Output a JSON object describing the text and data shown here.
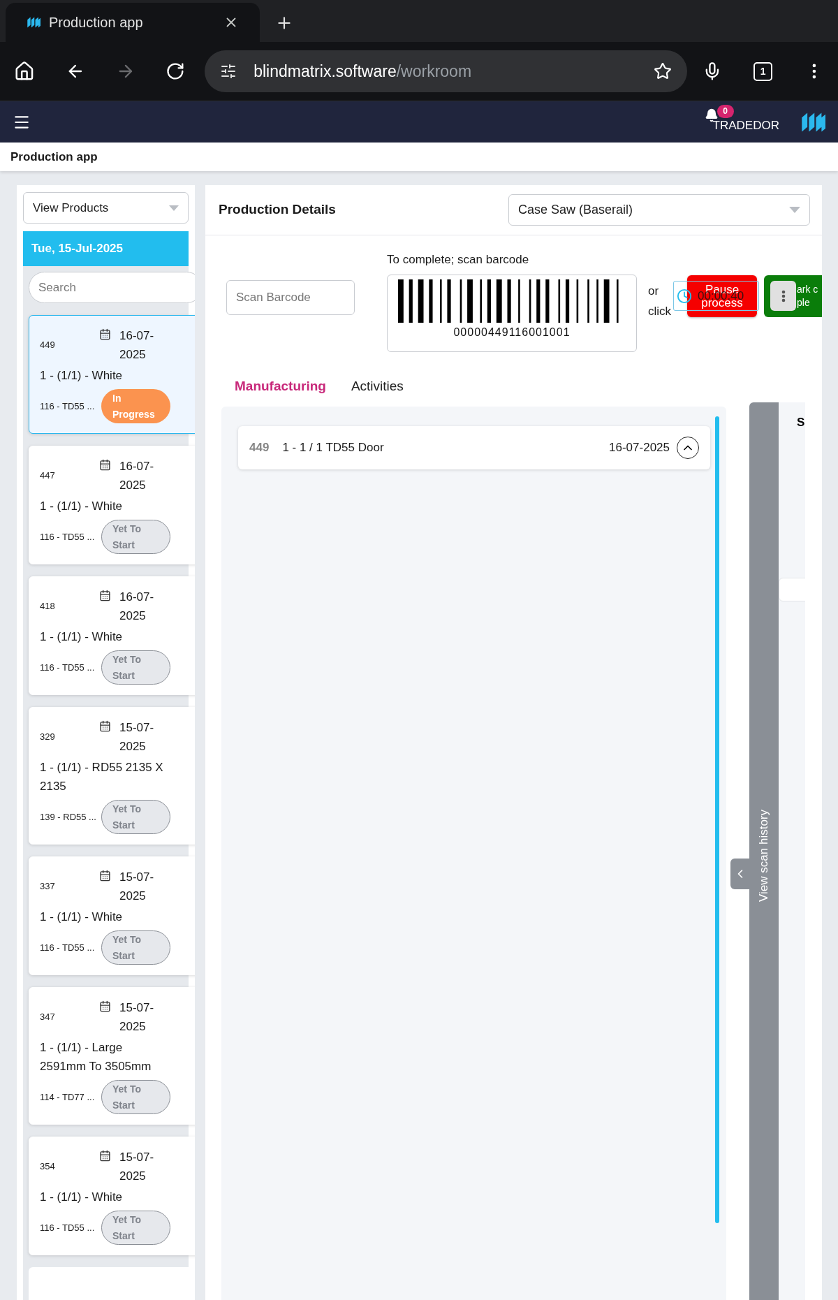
{
  "browser": {
    "tab_title": "Production app",
    "url_host": "blindmatrix.software",
    "url_path": "/workroom",
    "tab_count": "1",
    "forward_disabled": true
  },
  "header": {
    "notifications": "0",
    "user": "TRADEDOR"
  },
  "page_title": "Production app",
  "sidebar": {
    "product_select": "View Products",
    "date": "Tue, 15-Jul-2025",
    "search_placeholder": "Search",
    "orders": [
      {
        "number": "449",
        "date": "16-07-2025",
        "description": "1 - (1/1) - White",
        "code": "116 - TD55 ...",
        "status": "In Progress",
        "color": "#fb934f",
        "selected": true
      },
      {
        "number": "447",
        "date": "16-07-2025",
        "description": "1 - (1/1) - White",
        "code": "116 - TD55 ...",
        "status": "Yet To Start",
        "color": "#e6e8ec",
        "selected": false
      },
      {
        "number": "418",
        "date": "16-07-2025",
        "description": "1 - (1/1) - White",
        "code": "116 - TD55 ...",
        "status": "Yet To Start",
        "color": "#e6e8ec",
        "selected": false
      },
      {
        "number": "329",
        "date": "15-07-2025",
        "description": "1 - (1/1) - RD55 2135 X 2135",
        "code": "139 - RD55 ...",
        "status": "Yet To Start",
        "color": "#e6e8ec",
        "selected": false
      },
      {
        "number": "337",
        "date": "15-07-2025",
        "description": "1 - (1/1) - White",
        "code": "116 - TD55 ...",
        "status": "Yet To Start",
        "color": "#e6e8ec",
        "selected": false
      },
      {
        "number": "347",
        "date": "15-07-2025",
        "description": "1 - (1/1) - Large 2591mm To 3505mm",
        "code": "114 - TD77 ...",
        "status": "Yet To Start",
        "color": "#e6e8ec",
        "selected": false
      },
      {
        "number": "354",
        "date": "15-07-2025",
        "description": "1 - (1/1) - White",
        "code": "116 - TD55 ...",
        "status": "Yet To Start",
        "color": "#e6e8ec",
        "selected": false
      }
    ]
  },
  "main": {
    "title": "Production Details",
    "station": "Case Saw (Baserail)",
    "scan_placeholder": "Scan Barcode",
    "scan_hint": "To complete; scan barcode",
    "barcode": "00000449116001001",
    "or_text": "or click",
    "timer": "00:00:40",
    "pause_label": "Pause process",
    "complete_label_lines": [
      "ark c",
      "ple"
    ],
    "tabs": [
      {
        "label": "Manufacturing",
        "selected": true
      },
      {
        "label": "Activities",
        "selected": false
      }
    ],
    "items": [
      {
        "number": "449",
        "description": "1 - 1 / 1 TD55 Door",
        "date": "16-07-2025",
        "expanded": true
      }
    ],
    "scan_history": {
      "label": "View scan history",
      "heading": "S"
    }
  }
}
